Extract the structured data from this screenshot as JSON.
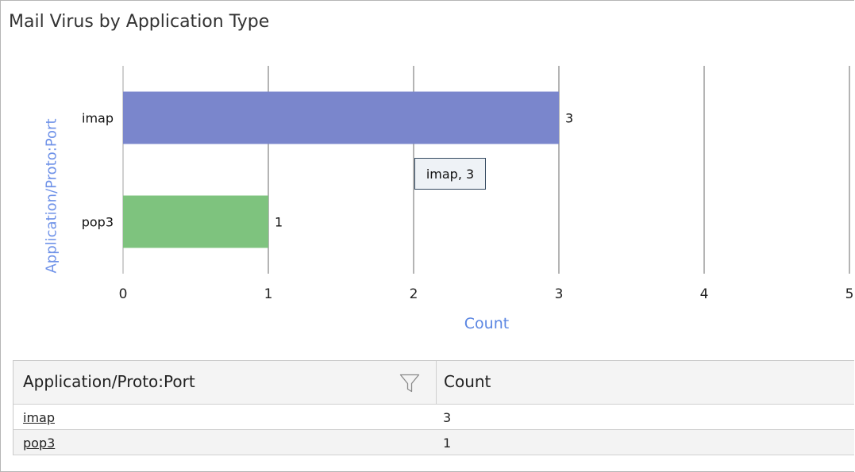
{
  "panel": {
    "title": "Mail Virus by Application Type"
  },
  "tooltip": {
    "text": "imap, 3"
  },
  "chart_data": {
    "type": "bar",
    "orientation": "horizontal",
    "title": "Mail Virus by Application Type",
    "xlabel": "Count",
    "ylabel": "Application/Proto:Port",
    "categories": [
      "imap",
      "pop3"
    ],
    "values": [
      3,
      1
    ],
    "colors": [
      "#7a86cc",
      "#7ec37e"
    ],
    "data_labels": [
      "3",
      "1"
    ],
    "xlim": [
      0,
      5
    ],
    "xticks": [
      "0",
      "1",
      "2",
      "3",
      "4",
      "5"
    ],
    "grid": "vertical",
    "legend": "none"
  },
  "table": {
    "headers": [
      "Application/Proto:Port",
      "Count"
    ],
    "rows": [
      {
        "app": "imap",
        "count": "3"
      },
      {
        "app": "pop3",
        "count": "1"
      }
    ]
  },
  "icons": {
    "filter": "filter-icon"
  },
  "colors": {
    "axis_label": "#5b86e2",
    "grid": "#6a6a6a",
    "axis": "#a0a0a0"
  }
}
